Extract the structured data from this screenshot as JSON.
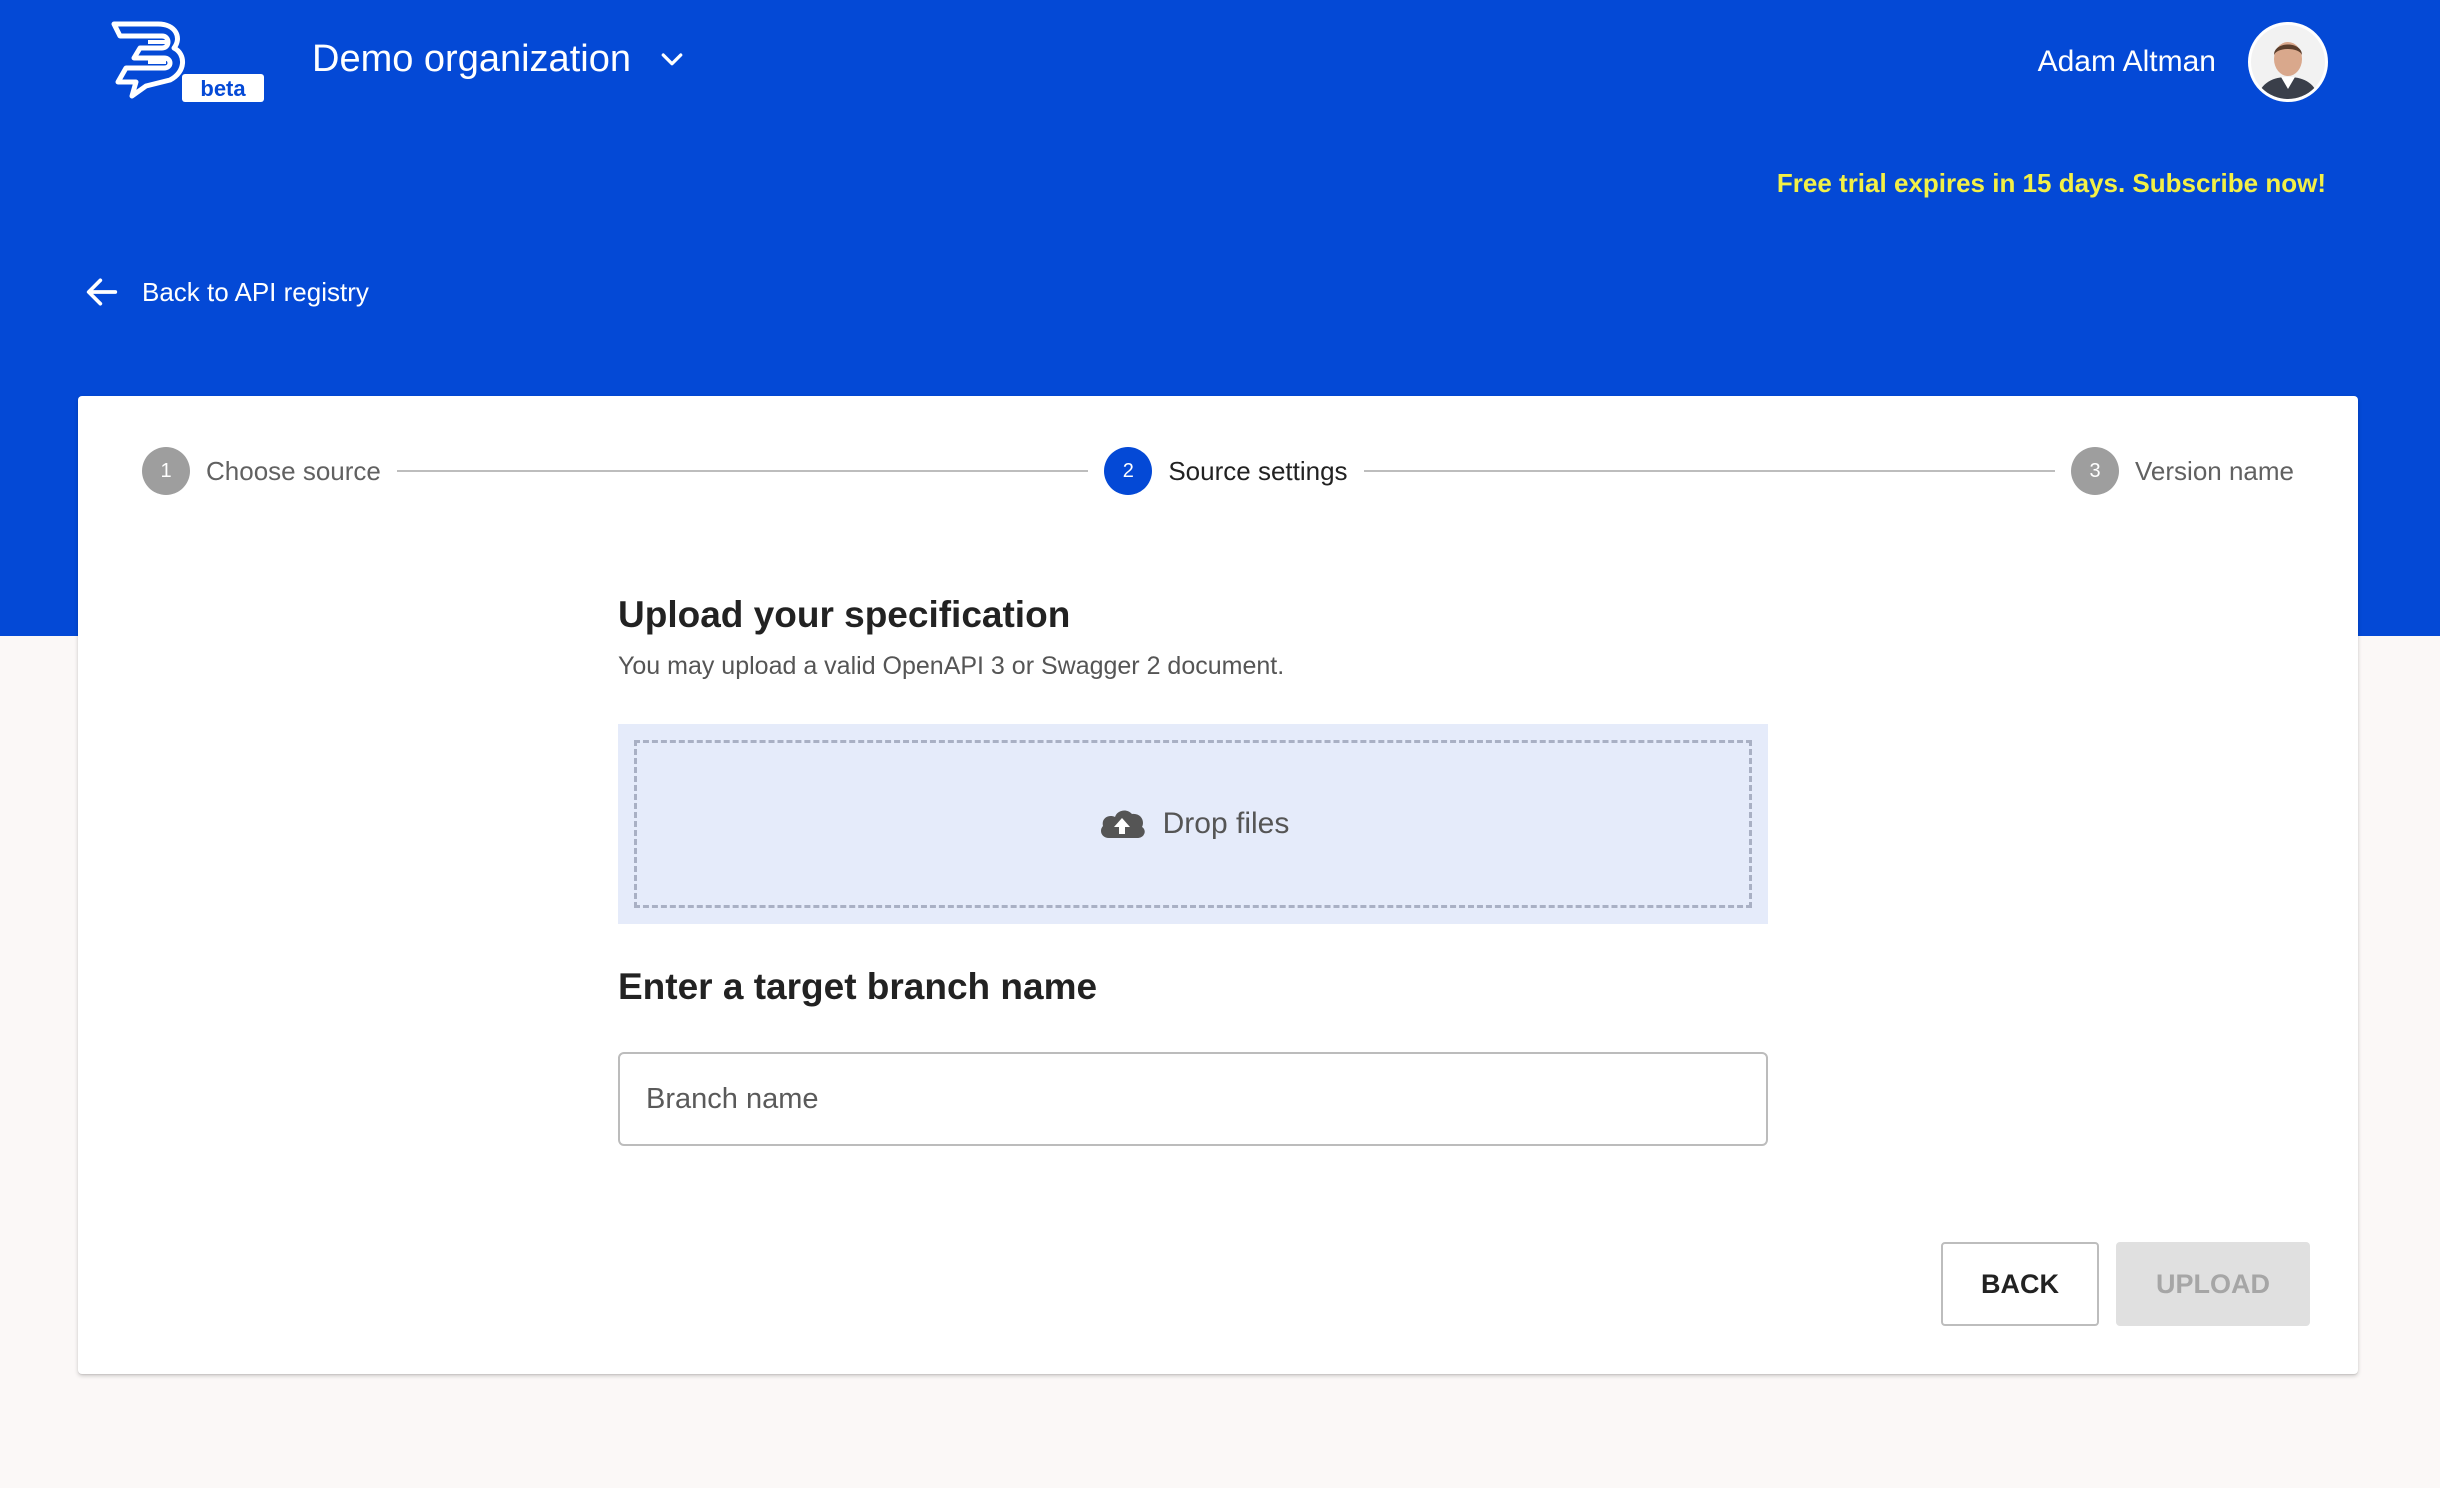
{
  "header": {
    "logo_badge": "beta",
    "org_name": "Demo organization",
    "user_name": "Adam Altman",
    "trial_text": "Free trial expires in 15 days. Subscribe now!"
  },
  "nav": {
    "back_link": "Back to API registry"
  },
  "stepper": {
    "steps": [
      {
        "number": "1",
        "label": "Choose source",
        "state": "inactive"
      },
      {
        "number": "2",
        "label": "Source settings",
        "state": "active"
      },
      {
        "number": "3",
        "label": "Version name",
        "state": "inactive"
      }
    ]
  },
  "upload": {
    "title": "Upload your specification",
    "subtitle": "You may upload a valid OpenAPI 3 or Swagger 2 document.",
    "dropzone_label": "Drop files"
  },
  "branch": {
    "title": "Enter a target branch name",
    "placeholder": "Branch name",
    "value": ""
  },
  "actions": {
    "back": "BACK",
    "upload": "UPLOAD",
    "upload_disabled": true
  },
  "colors": {
    "brand_blue": "#0449d6",
    "trial_yellow": "#f3f046",
    "page_bg": "#fbf8f7",
    "dropzone_bg": "#e5ebfa"
  },
  "icons": [
    "logo-icon",
    "chevron-down-icon",
    "avatar",
    "arrow-left-icon",
    "cloud-upload-icon"
  ]
}
